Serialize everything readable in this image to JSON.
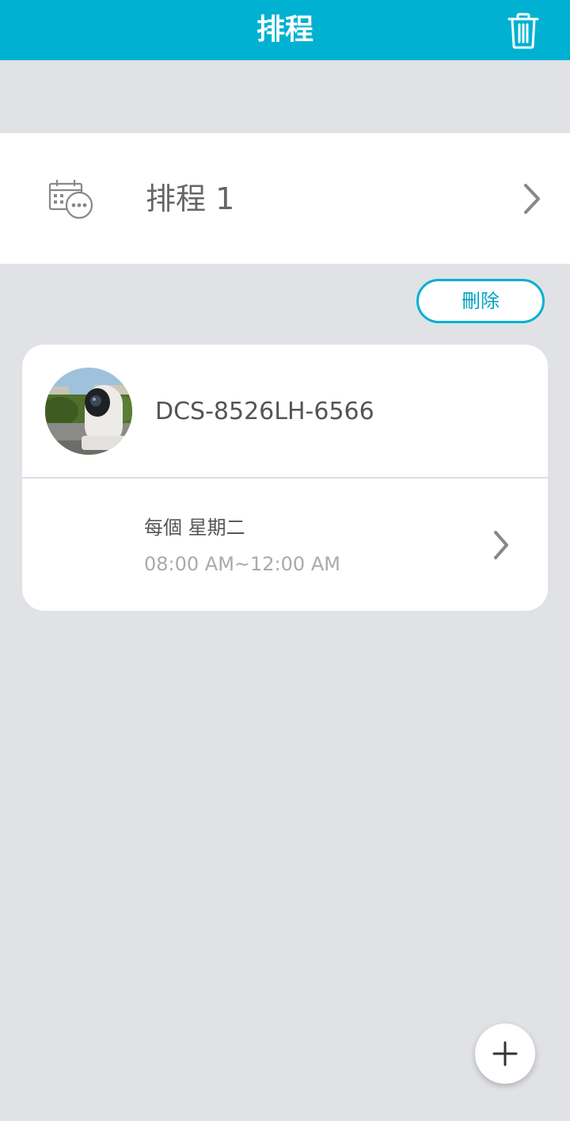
{
  "header": {
    "title": "排程",
    "trash_icon": "trash-icon"
  },
  "schedule": {
    "icon": "calendar-more-icon",
    "name": "排程 1"
  },
  "actions": {
    "delete_label": "刪除"
  },
  "device_card": {
    "device_name": "DCS-8526LH-6566",
    "repeat": "每個 星期二",
    "time_range": "08:00 AM~12:00 AM"
  },
  "fab": {
    "icon": "plus-icon"
  },
  "colors": {
    "accent": "#00b1d2",
    "background": "#e0e2e6",
    "card": "#ffffff"
  }
}
